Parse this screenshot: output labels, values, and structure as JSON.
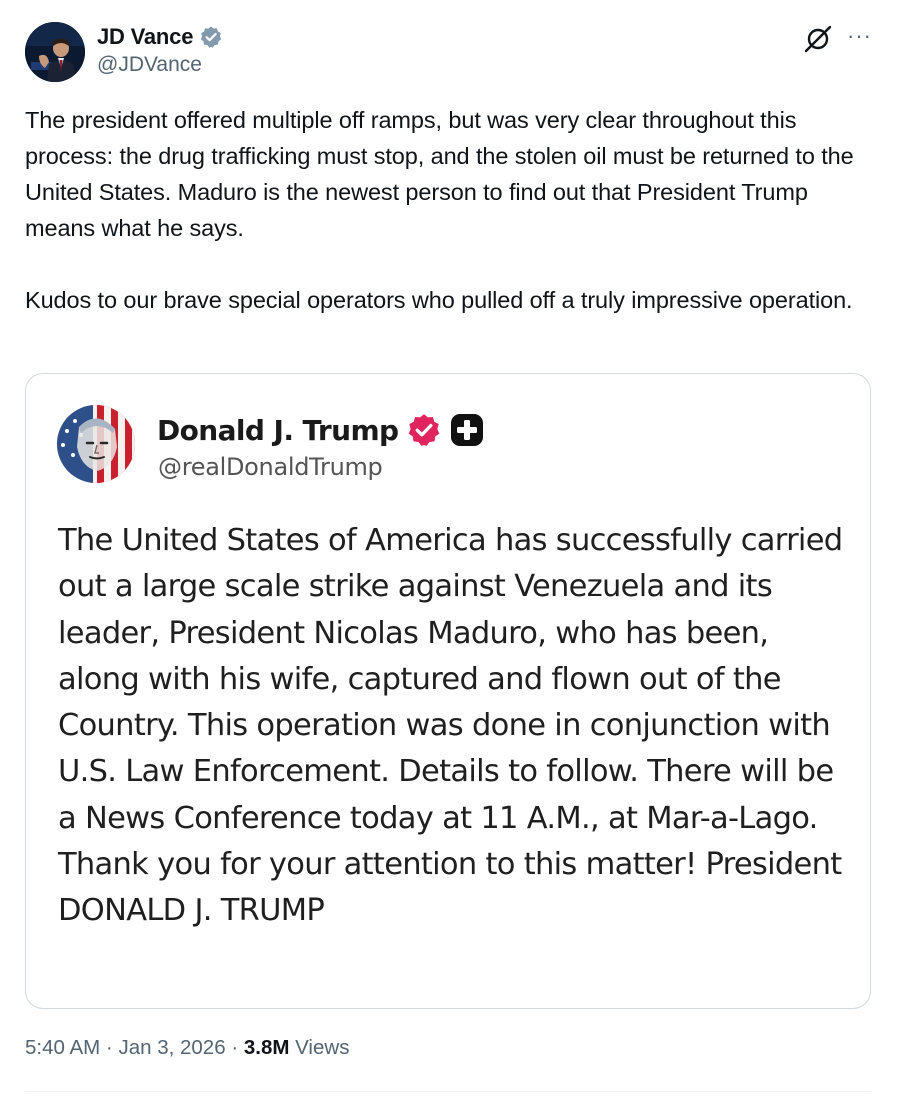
{
  "tweet": {
    "author": {
      "name": "JD Vance",
      "handle": "@JDVance",
      "avatar_icon": "profile-photo",
      "verified_badge_color": "#829aab"
    },
    "actions": {
      "grok_icon": "grok-icon",
      "more_icon": "more-icon",
      "more_label": "···"
    },
    "text": {
      "paragraph_1": "The president offered multiple off ramps, but was very clear throughout this process: the drug trafficking must stop, and the stolen oil must be returned to the United States. Maduro is the newest person to find out that President Trump means what he says.",
      "paragraph_2": "Kudos to our brave special operators who pulled off a truly impressive operation."
    },
    "quote": {
      "name": "Donald J. Trump",
      "handle": "@realDonaldTrump",
      "verified_badge_color": "#e0245e",
      "plus_badge_icon": "truth-plus-icon",
      "text": "The United States of America has successfully carried out a large scale strike against Venezuela and its leader, President Nicolas Maduro, who has been, along with his wife, captured and flown out of the Country. This operation was done in conjunction with U.S. Law Enforcement. Details to follow. There will be a News Conference today at 11 A.M., at Mar-a-Lago. Thank you for your attention to this matter! President DONALD J. TRUMP"
    },
    "meta": {
      "time": "5:40 AM",
      "separator": "·",
      "date": "Jan 3, 2026",
      "views_count": "3.8M",
      "views_label": "Views"
    },
    "colors": {
      "text_primary": "#0f1419",
      "text_secondary": "#536471",
      "border": "#cfd9de"
    }
  }
}
